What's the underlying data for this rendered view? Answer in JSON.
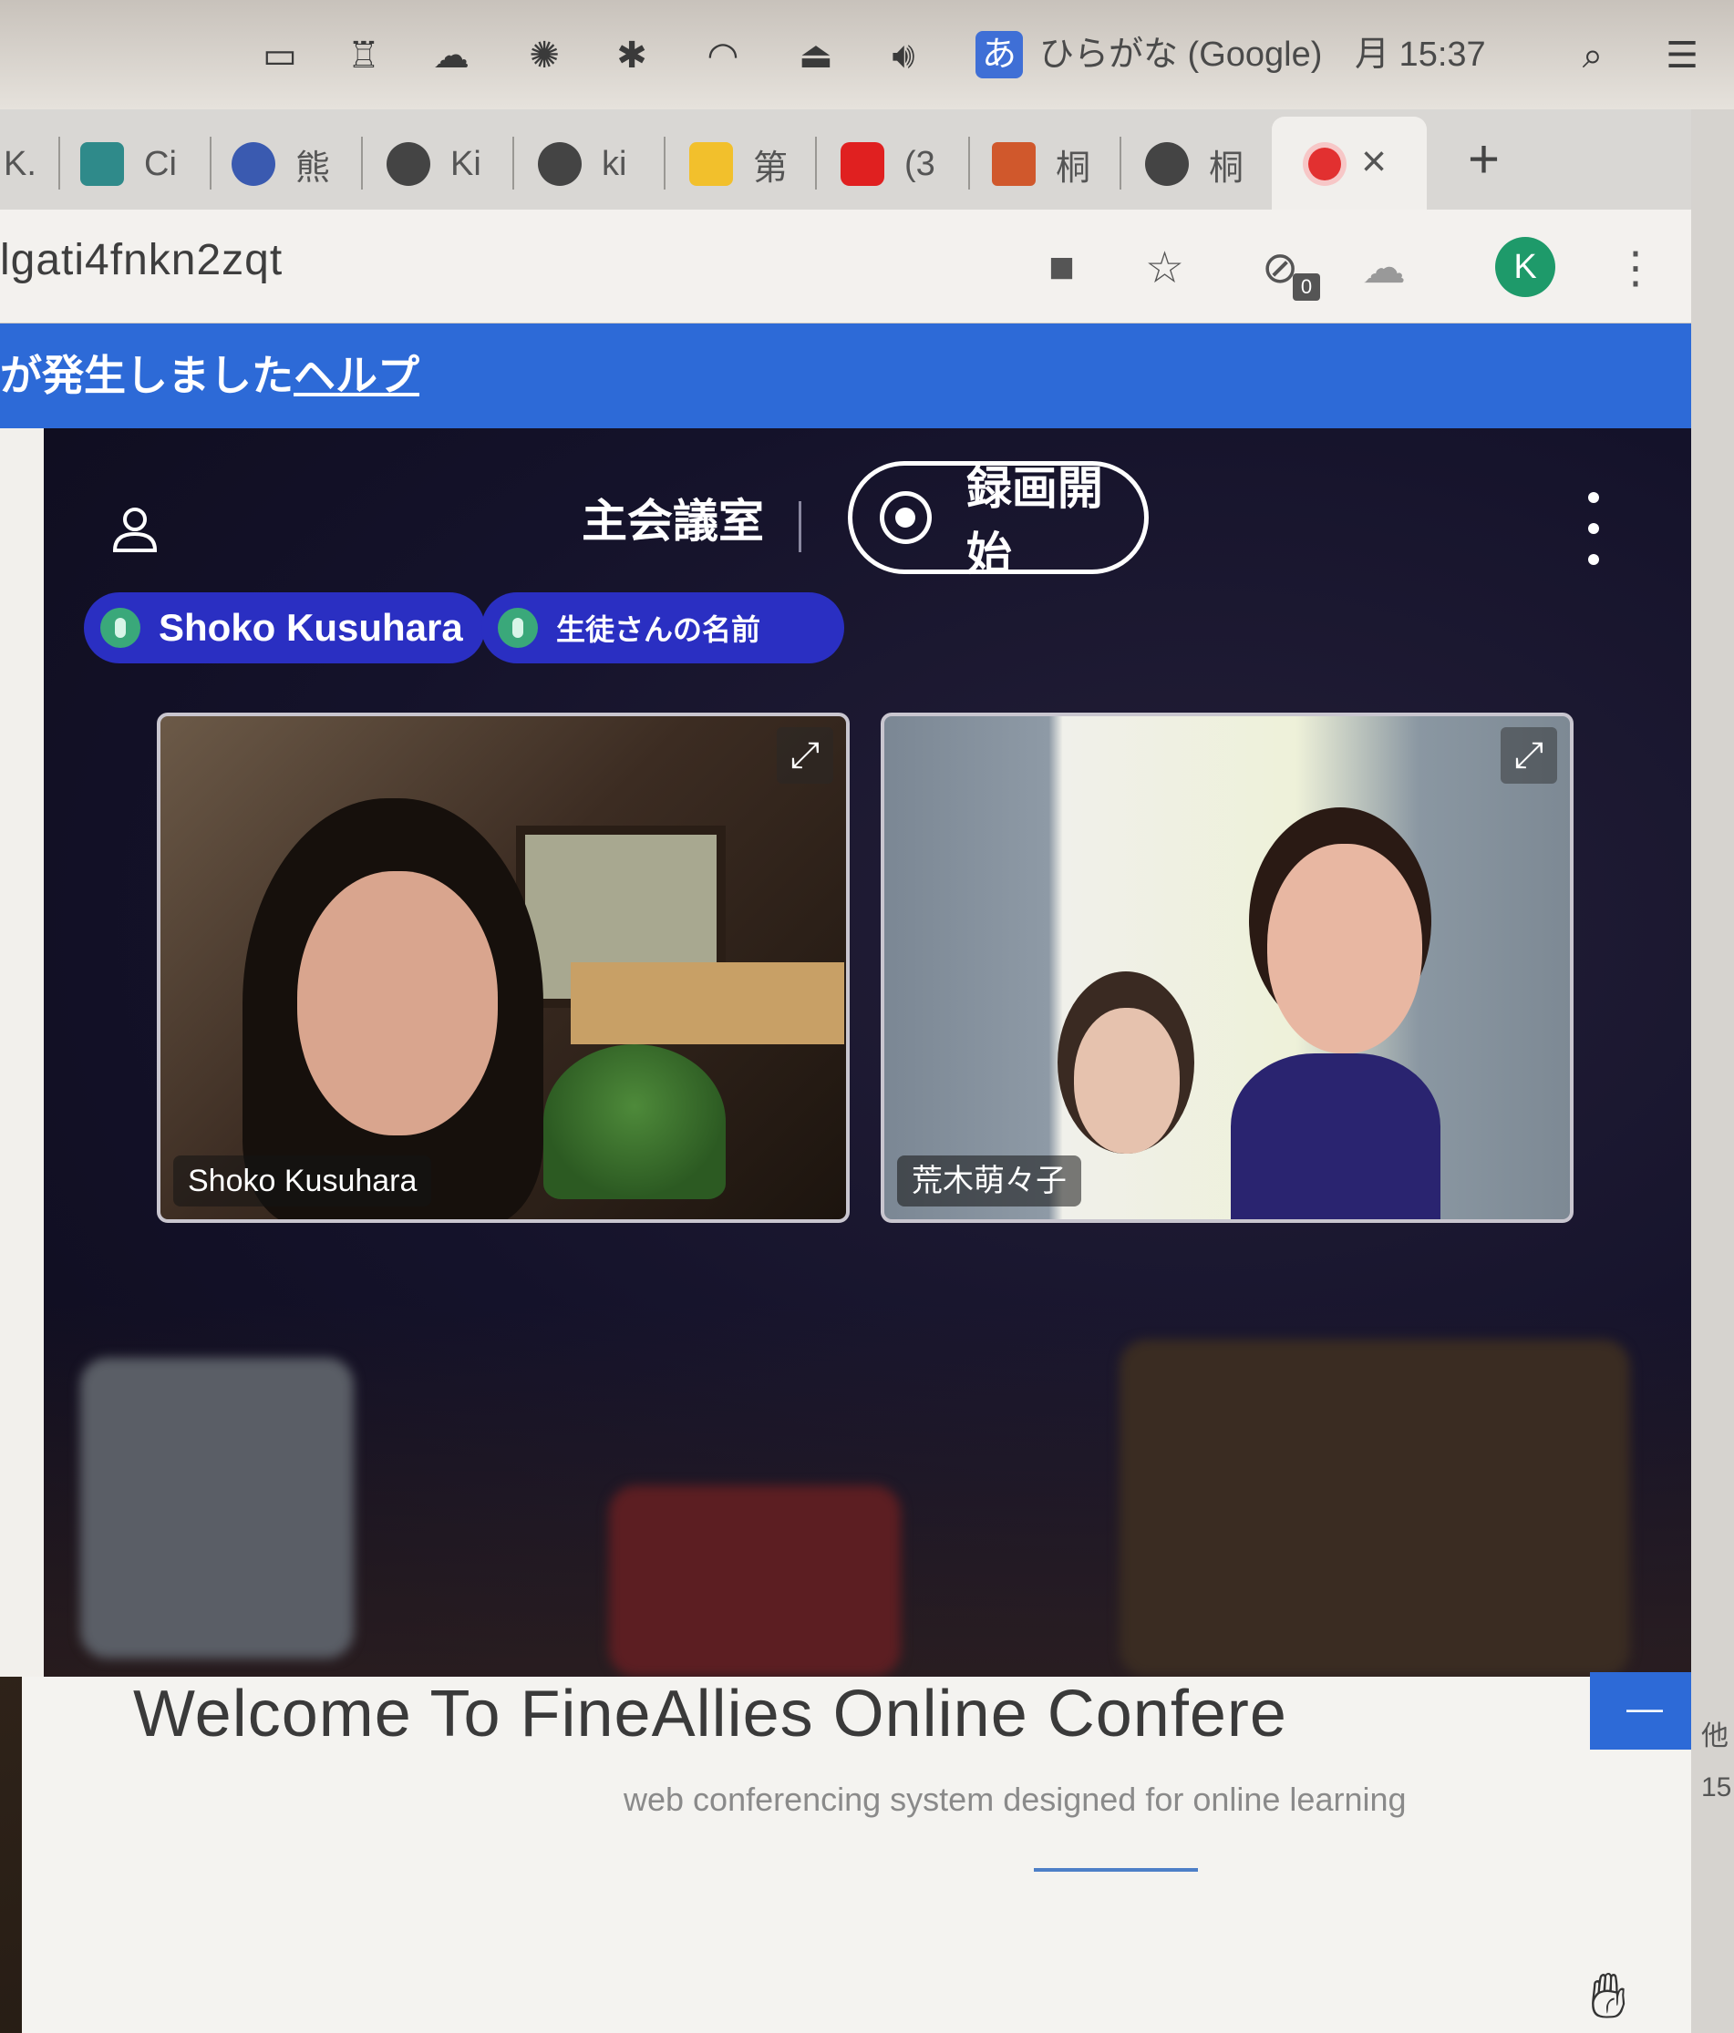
{
  "menubar": {
    "ime_badge": "あ",
    "ime_label": "ひらがな (Google)",
    "clock": "月 15:37"
  },
  "tabs": [
    {
      "label": "K."
    },
    {
      "label": "Ci"
    },
    {
      "label": "熊"
    },
    {
      "label": "Ki"
    },
    {
      "label": "ki"
    },
    {
      "label": "第"
    },
    {
      "label": "(3"
    },
    {
      "label": "桐"
    },
    {
      "label": "桐"
    }
  ],
  "address": {
    "url": "lgati4fnkn2zqt",
    "extension_badge": "0",
    "avatar_letter": "K"
  },
  "banner": {
    "text": "が発生しました",
    "help_link": "ヘルプ"
  },
  "conference": {
    "room_title": "主会議室",
    "record_button": "録画開始",
    "participants": [
      {
        "chip_name": "Shoko Kusuhara"
      },
      {
        "chip_name": "生徒さんの名前"
      }
    ],
    "videos": [
      {
        "name_tag": "Shoko Kusuhara"
      },
      {
        "name_tag": "荒木萌々子"
      }
    ]
  },
  "page": {
    "welcome": "Welcome To FineAllies Online Confere",
    "subtitle": "web conferencing system designed for online learning",
    "collapse_button": "—"
  },
  "edge": {
    "text1": "他",
    "text2": "15"
  }
}
